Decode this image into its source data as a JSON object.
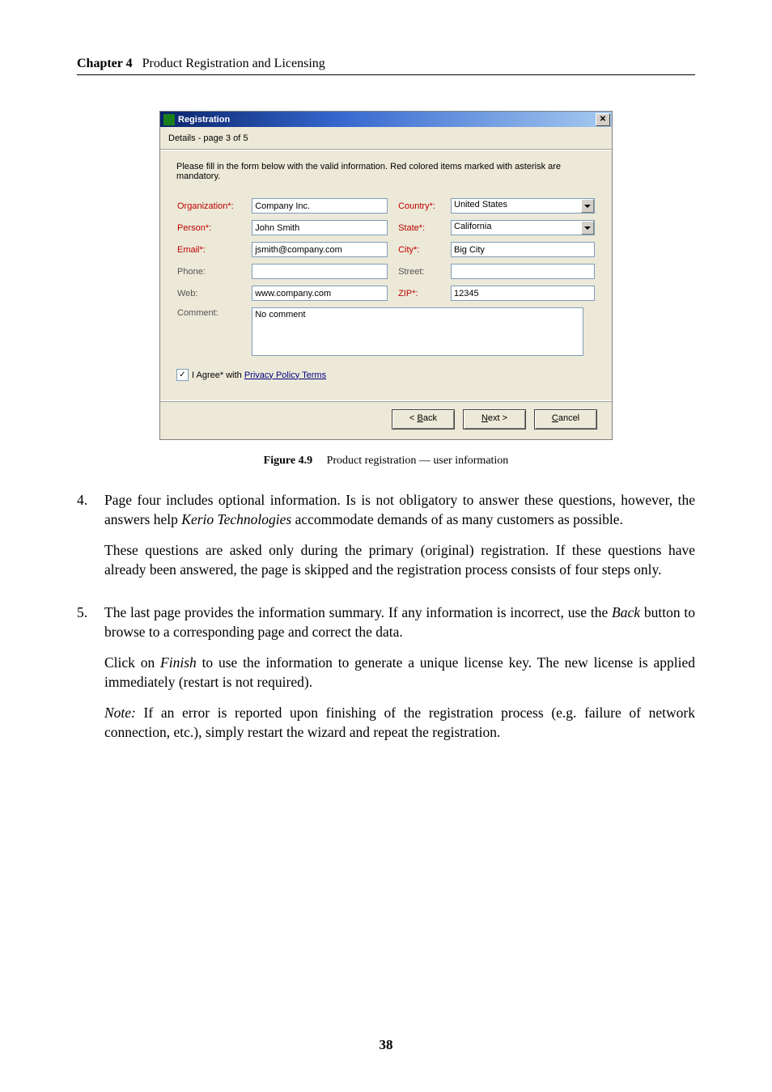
{
  "header": {
    "chapter_label": "Chapter 4",
    "chapter_title": "Product Registration and Licensing"
  },
  "dialog": {
    "title": "Registration",
    "close_glyph": "✕",
    "subtitle": "Details - page 3 of 5",
    "intro": "Please fill in the form below with the valid information. Red colored items marked with asterisk are mandatory.",
    "labels": {
      "organization": "Organization*:",
      "country": "Country*:",
      "person": "Person*:",
      "state": "State*:",
      "email": "Email*:",
      "city": "City*:",
      "phone": "Phone:",
      "street": "Street:",
      "web": "Web:",
      "zip": "ZIP*:",
      "comment": "Comment:"
    },
    "values": {
      "organization": "Company Inc.",
      "country": "United States",
      "person": "John Smith",
      "state": "California",
      "email": "jsmith@company.com",
      "city": "Big City",
      "phone": "",
      "street": "",
      "web": "www.company.com",
      "zip": "12345",
      "comment": "No comment"
    },
    "agree": {
      "checked_glyph": "✓",
      "prefix": "I Agree* with ",
      "link": "Privacy Policy Terms"
    },
    "buttons": {
      "back_pre": "< ",
      "back_u": "B",
      "back_post": "ack",
      "next_u": "N",
      "next_post": "ext >",
      "cancel_u": "C",
      "cancel_post": "ancel"
    }
  },
  "figure": {
    "label": "Figure 4.9",
    "caption": "Product registration — user information"
  },
  "body": {
    "item4": {
      "num": "4.",
      "p1_a": "Page four includes optional information. Is is not obligatory to answer these questions, however, the answers help ",
      "p1_i": "Kerio Technologies",
      "p1_b": " accommodate demands of as many customers as possible.",
      "p2": "These questions are asked only during the primary (original) registration. If these questions have already been answered, the page is skipped and the registration process consists of four steps only."
    },
    "item5": {
      "num": "5.",
      "p1_a": "The last page provides the information summary. If any information is incorrect, use the ",
      "p1_i": "Back",
      "p1_b": " button to browse to a corresponding page and correct the data.",
      "p2_a": "Click on ",
      "p2_i": "Finish",
      "p2_b": " to use the information to generate a unique license key. The new license is applied immediately (restart is not required).",
      "p3_i": "Note:",
      "p3_b": " If an error is reported upon finishing of the registration process (e.g. failure of network connection, etc.), simply restart the wizard and repeat the registration."
    }
  },
  "page_number": "38"
}
